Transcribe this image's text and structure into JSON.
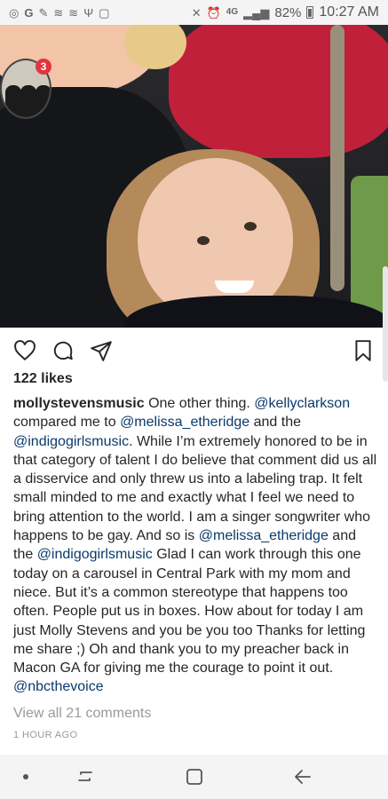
{
  "status_bar": {
    "battery": "82%",
    "time": "10:27 AM",
    "network": "4G"
  },
  "story": {
    "badge_count": "3"
  },
  "post": {
    "likes": "122 likes",
    "username": "mollystevensmusic",
    "caption_parts": [
      {
        "type": "text",
        "text": " One other thing. "
      },
      {
        "type": "mention",
        "text": "@kellyclarkson"
      },
      {
        "type": "text",
        "text": " compared me to "
      },
      {
        "type": "mention",
        "text": "@melissa_etheridge"
      },
      {
        "type": "text",
        "text": " and the "
      },
      {
        "type": "mention",
        "text": "@indigogirlsmusic"
      },
      {
        "type": "text",
        "text": ". While I’m extremely honored to be in that category of talent I do believe that comment did us all a disservice and only threw us into a labeling trap. It felt small minded to me and exactly what I feel we need to bring attention to the world. I am a singer songwriter who happens to be gay. And so is "
      },
      {
        "type": "mention",
        "text": "@melissa_etheridge"
      },
      {
        "type": "text",
        "text": " and the "
      },
      {
        "type": "mention",
        "text": "@indigogirlsmusic"
      },
      {
        "type": "text",
        "text": " Glad I can work through this one today on a carousel in Central Park with my mom and niece. But it’s a common stereotype that happens too often. People put us in boxes. How about for today I am just Molly Stevens and you be you too Thanks for letting me share ;) Oh and thank you to my preacher back in Macon GA for giving me the courage to point it out. "
      },
      {
        "type": "mention",
        "text": "@nbcthevoice"
      }
    ],
    "view_comments": "View all 21 comments",
    "timestamp": "1 HOUR AGO"
  },
  "icons": {
    "like": "heart-icon",
    "comment": "comment-icon",
    "share": "send-icon",
    "save": "bookmark-icon",
    "nav_recent": "recent-apps-icon",
    "nav_home": "home-icon",
    "nav_back": "back-icon"
  },
  "colors": {
    "mention": "#0b3a6b",
    "badge": "#e2343f",
    "muted": "#999999"
  }
}
